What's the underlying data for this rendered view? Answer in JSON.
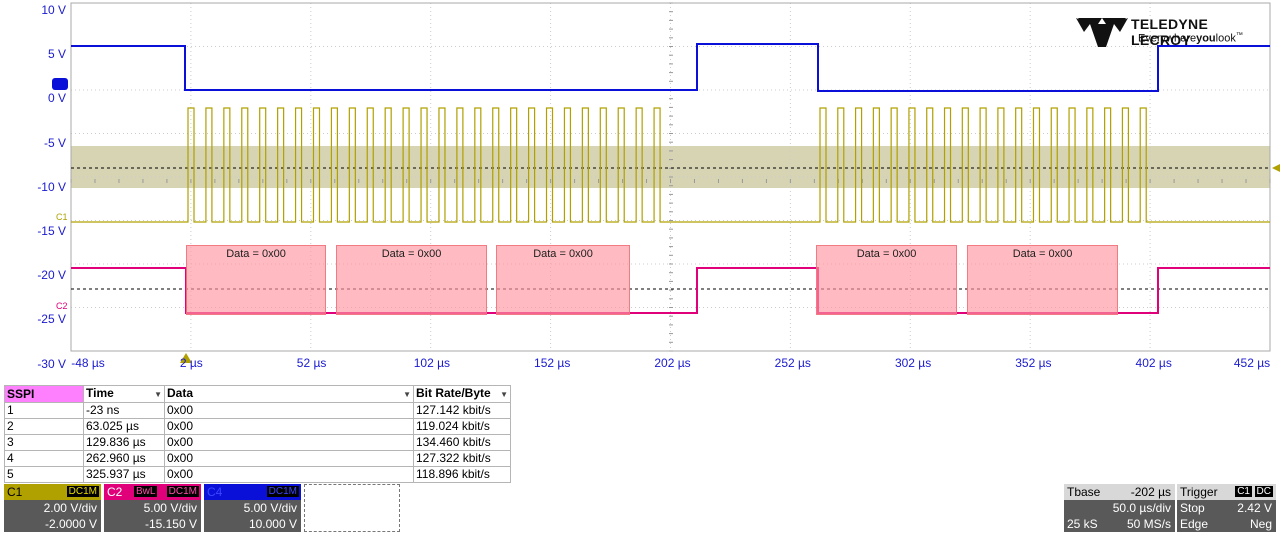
{
  "colors": {
    "c1": "#b0a000",
    "c2": "#e0007a",
    "c4": "#0a10d8",
    "axis": "#1a1ad0"
  },
  "y_axis": {
    "labels": [
      "10 V",
      "5 V",
      "0 V",
      "-5 V",
      "-10 V",
      "-15 V",
      "-20 V",
      "-25 V",
      "-30 V"
    ]
  },
  "x_axis": {
    "labels": [
      "-48 µs",
      "2 µs",
      "52 µs",
      "102 µs",
      "152 µs",
      "202 µs",
      "252 µs",
      "302 µs",
      "352 µs",
      "402 µs",
      "452 µs"
    ]
  },
  "trace_markers": {
    "c1": "C1",
    "c2": "C2"
  },
  "decode": {
    "annotations": [
      "Data = 0x00",
      "Data = 0x00",
      "Data = 0x00",
      "Data = 0x00",
      "Data = 0x00"
    ]
  },
  "logo": {
    "brand": "TELEDYNE LECROY",
    "tagline_pre": "Everywhere",
    "tagline_bold": "you",
    "tagline_post": "look",
    "tm": "™",
    "icon": "teledyne-logo-icon"
  },
  "table": {
    "headers": {
      "protocol": "SSPI",
      "time": "Time",
      "data": "Data",
      "rate": "Bit Rate/Byte"
    },
    "rows": [
      {
        "idx": "1",
        "time": "-23 ns",
        "data": "0x00",
        "rate": "127.142 kbit/s"
      },
      {
        "idx": "2",
        "time": "63.025 µs",
        "data": "0x00",
        "rate": "119.024 kbit/s"
      },
      {
        "idx": "3",
        "time": "129.836 µs",
        "data": "0x00",
        "rate": "134.460 kbit/s"
      },
      {
        "idx": "4",
        "time": "262.960 µs",
        "data": "0x00",
        "rate": "127.322 kbit/s"
      },
      {
        "idx": "5",
        "time": "325.937 µs",
        "data": "0x00",
        "rate": "118.896 kbit/s"
      }
    ]
  },
  "channels": {
    "c1": {
      "name": "C1",
      "badge1": "DC1M",
      "vdiv": "2.00 V/div",
      "offset": "-2.0000 V"
    },
    "c2": {
      "name": "C2",
      "badge0": "BwL",
      "badge1": "DC1M",
      "vdiv": "5.00 V/div",
      "offset": "-15.150 V"
    },
    "c4": {
      "name": "C4",
      "badge1": "DC1M",
      "vdiv": "5.00 V/div",
      "offset": "10.000 V"
    }
  },
  "timebase": {
    "label": "Tbase",
    "delay": "-202 µs",
    "tdiv": "50.0 µs/div",
    "samples": "25 kS",
    "rate": "50 MS/s"
  },
  "trigger": {
    "label": "Trigger",
    "ch": "C1",
    "coupling": "DC",
    "mode": "Stop",
    "level": "2.42 V",
    "type": "Edge",
    "slope": "Neg"
  }
}
